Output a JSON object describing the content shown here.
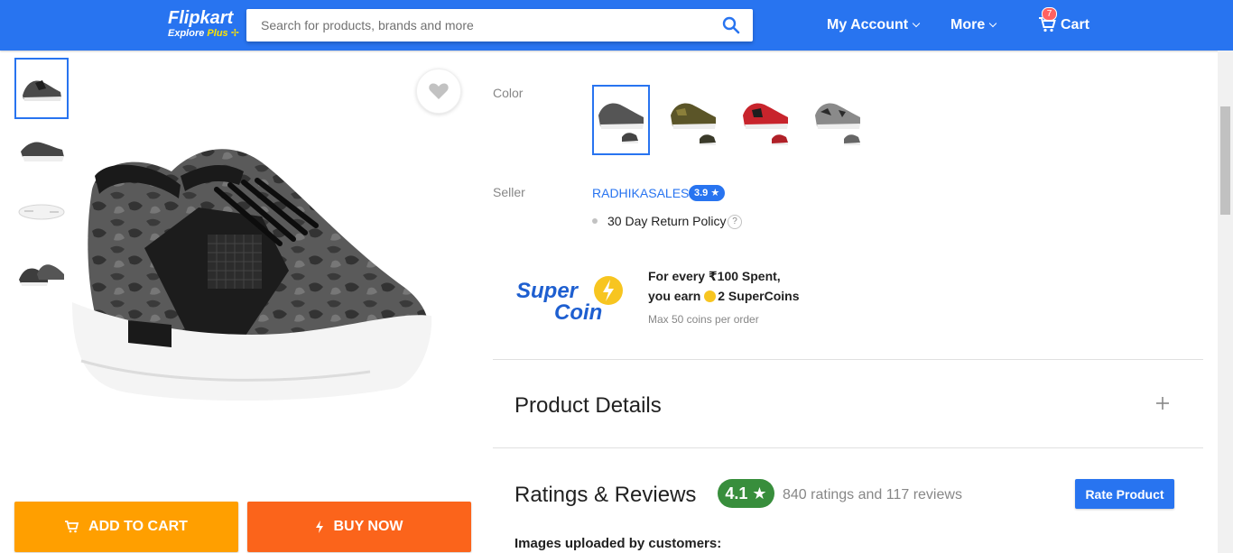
{
  "header": {
    "logo_text": "Flipkart",
    "logo_sub_explore": "Explore",
    "logo_sub_plus": "Plus",
    "search_placeholder": "Search for products, brands and more",
    "my_account": "My Account",
    "more": "More",
    "cart": "Cart",
    "cart_count": "7"
  },
  "product": {
    "add_to_cart": "ADD TO CART",
    "buy_now": "BUY NOW"
  },
  "details": {
    "color_label": "Color",
    "seller_label": "Seller",
    "seller_name": "RADHIKASALES",
    "seller_rating": "3.9 ★",
    "return_policy": "30 Day Return Policy",
    "help": "?",
    "supercoin": {
      "line1": "For every ₹100 Spent,",
      "line2_prefix": "you earn ",
      "line2_value": "2 SuperCoins",
      "note": "Max 50 coins per order"
    },
    "product_details_title": "Product Details",
    "ratings_title": "Ratings & Reviews",
    "rating_value": "4.1 ★",
    "rating_count": "840 ratings and 117 reviews",
    "rate_product": "Rate Product",
    "images_uploaded": "Images uploaded by customers:"
  },
  "colors": {
    "accent": "#2874f0",
    "cart_button": "#ff9f00",
    "buy_button": "#fb641b",
    "rating_green": "#388e3c"
  }
}
